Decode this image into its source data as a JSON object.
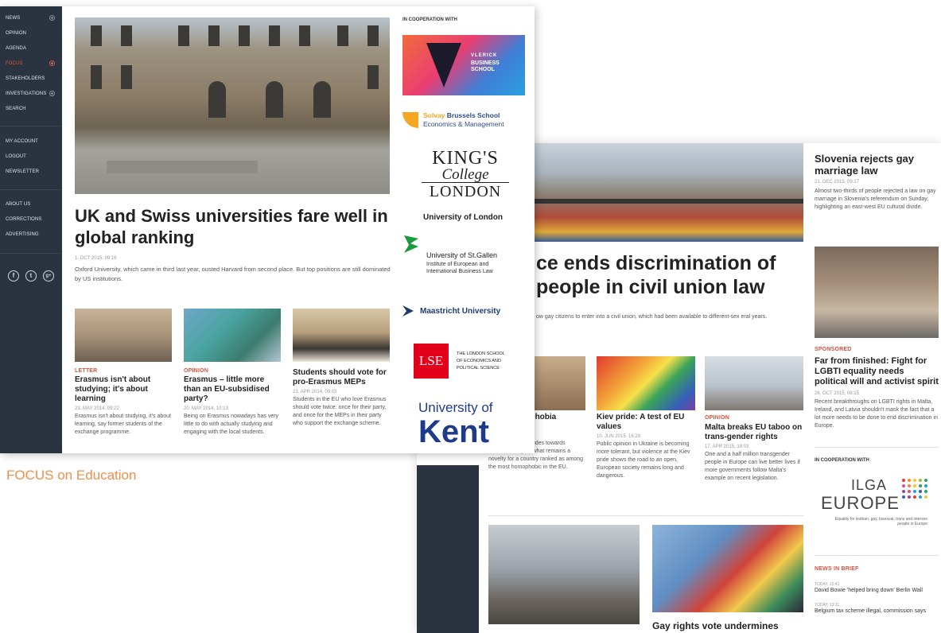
{
  "caption": "FOCUS on Education",
  "front": {
    "nav": {
      "items": [
        "NEWS",
        "OPINION",
        "AGENDA",
        "FOCUS",
        "STAKEHOLDERS",
        "INVESTIGATIONS",
        "SEARCH"
      ],
      "account_items": [
        "MY ACCOUNT",
        "LOGOUT",
        "NEWSLETTER"
      ],
      "info_items": [
        "ABOUT US",
        "CORRECTIONS",
        "ADVERTISING"
      ],
      "social": [
        "f",
        "t",
        "g+"
      ]
    },
    "hero": {
      "title": "UK and Swiss universities fare well in global ranking",
      "meta": "1. OCT 2015, 09:16",
      "excerpt": "Oxford University, which came in third last year, ousted Harvard from second place. But top positions are still dominated by US institutions."
    },
    "cards": [
      {
        "tag": "LETTER",
        "title": "Erasmus isn't about studying; it's about learning",
        "meta": "23. MAY 2014, 09:22",
        "excerpt": "Erasmus isn't about studying, it's about learning, say former students of the exchange programme."
      },
      {
        "tag": "OPINION",
        "title": "Erasmus – little more than an EU-subsidised party?",
        "meta": "20. MAY 2014, 10:13",
        "excerpt": "Being on Erasmus nowadays has very little to do with actually studying and engaging with the local students."
      },
      {
        "tag": "",
        "title": "Students should vote for pro-Erasmus MEPs",
        "meta": "23. APR 2014, 09:03",
        "excerpt": "Students in the EU who love Erasmus should vote twice: once for their party, and once for the MEPs in their party who support the exchange scheme."
      }
    ],
    "cooperation": {
      "heading": "IN COOPERATION WITH",
      "vlerick": "BUSINESS SCHOOL",
      "vlerick_name": "VLERICK",
      "solvay_1a": "Solvay",
      "solvay_1b": " Brussels School",
      "solvay_2": "Economics & Management",
      "kings_1": "KING'S",
      "kings_2": "College",
      "kings_3": "LONDON",
      "uol": "University of London",
      "stgallen_1": "University of St.Gallen",
      "stgallen_2": "Institute of European and International Business Law",
      "maastricht": "Maastricht University",
      "lse_box": "LSE",
      "lse_1": "THE LONDON SCHOOL",
      "lse_2": "OF ECONOMICS AND",
      "lse_3": "POLITICAL SCIENCE",
      "kent_1": "University of",
      "kent_2": "Kent"
    }
  },
  "back": {
    "hero": {
      "title": "ce ends discrimination of people in civil union law",
      "excerpt": "ow gay citizens to enter into a civil union, which had been available to different-sex eral years."
    },
    "cards": [
      {
        "tag": "",
        "title": "grappies phobia",
        "meta": "",
        "excerpt": "discussing its attitudes towards homosexuality, in what remains a novelty for a country ranked as among the most homophobic in the EU."
      },
      {
        "tag": "",
        "title": "Kiev pride: A test of EU values",
        "meta": "10. JUN 2015, 16:28",
        "excerpt": "Public opinion in Ukraine is becoming more tolerant, but violence at the Kiev pride shows the road to an open, European society remains long and dangerous."
      },
      {
        "tag": "OPINION",
        "title": "Malta breaks EU taboo on trans-gender rights",
        "meta": "17. APR 2015, 19:03",
        "excerpt": "One and a half million transgender people in Europe can live better lives if more governments follow Malta's example on recent legislation."
      }
    ],
    "row2_title": "Gay rights vote undermines",
    "side": {
      "title": "Slovenia rejects gay marriage law",
      "meta": "21. DEC 2015, 09:17",
      "excerpt": "Almost two-thirds of people rejected a law on gay marriage in Slovenia's referendum on Sunday, highlighting an east-west EU cultural divide.",
      "sp_tag": "SPONSORED",
      "sp_title": "Far from finished: Fight for LGBTI equality needs political will and activist spirit",
      "sp_meta": "26. OCT 2015, 08:15",
      "sp_excerpt": "Recent breakthroughs on LGBTI rights in Malta, Ireland, and Latvia shouldn't mask the fact that a lot more needs to be done to end discrimination in Europe.",
      "coop": "IN COOPERATION WITH",
      "ilga_1": "ILGA",
      "ilga_2": "EUROPE",
      "ilga_sub": "Equality for lesbian, gay, bisexual, trans and intersex people in Europe",
      "nib_tag": "NEWS IN BRIEF",
      "nib": [
        {
          "time": "TODAY, 13:41",
          "text": "David Bowie 'helped bring down' Berlin Wall"
        },
        {
          "time": "TODAY, 13:11",
          "text": "Belgium tax scheme illegal, commission says"
        }
      ]
    }
  }
}
